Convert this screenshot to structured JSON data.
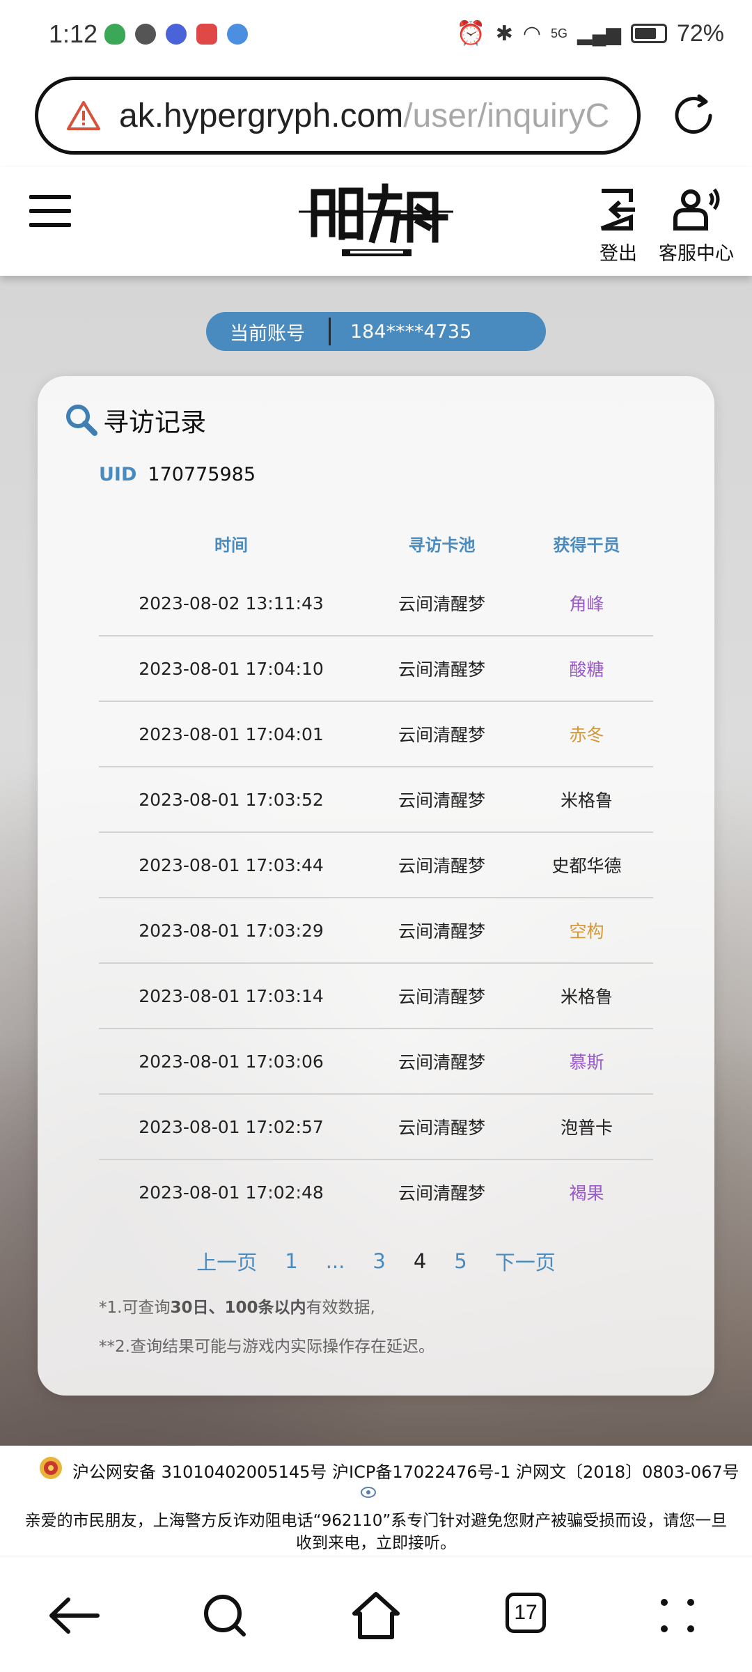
{
  "status_bar": {
    "time": "1:12",
    "network": "5G",
    "battery": "72%"
  },
  "browser": {
    "url_host": "ak.hypergryph.com",
    "url_path": "/user/inquiryC"
  },
  "header": {
    "logout_label": "登出",
    "service_label": "客服中心"
  },
  "account": {
    "label": "当前账号",
    "value": "184****4735"
  },
  "card": {
    "title": "寻访记录",
    "uid_label": "UID",
    "uid_value": "170775985",
    "columns": [
      "时间",
      "寻访卡池",
      "获得干员"
    ],
    "rows": [
      {
        "time": "2023-08-02 13:11:43",
        "pool": "云间清醒梦",
        "operator": "角峰",
        "color": "#9b59c9"
      },
      {
        "time": "2023-08-01 17:04:10",
        "pool": "云间清醒梦",
        "operator": "酸糖",
        "color": "#9b59c9"
      },
      {
        "time": "2023-08-01 17:04:01",
        "pool": "云间清醒梦",
        "operator": "赤冬",
        "color": "#d49a3a"
      },
      {
        "time": "2023-08-01 17:03:52",
        "pool": "云间清醒梦",
        "operator": "米格鲁",
        "color": "#222222"
      },
      {
        "time": "2023-08-01 17:03:44",
        "pool": "云间清醒梦",
        "operator": "史都华德",
        "color": "#222222"
      },
      {
        "time": "2023-08-01 17:03:29",
        "pool": "云间清醒梦",
        "operator": "空构",
        "color": "#d49a3a"
      },
      {
        "time": "2023-08-01 17:03:14",
        "pool": "云间清醒梦",
        "operator": "米格鲁",
        "color": "#222222"
      },
      {
        "time": "2023-08-01 17:03:06",
        "pool": "云间清醒梦",
        "operator": "慕斯",
        "color": "#9b59c9"
      },
      {
        "time": "2023-08-01 17:02:57",
        "pool": "云间清醒梦",
        "operator": "泡普卡",
        "color": "#222222"
      },
      {
        "time": "2023-08-01 17:02:48",
        "pool": "云间清醒梦",
        "operator": "褐果",
        "color": "#9b59c9"
      }
    ],
    "pagination": {
      "prev": "上一页",
      "p1": "1",
      "ellipsis": "...",
      "p3": "3",
      "current": "4",
      "p5": "5",
      "next": "下一页"
    },
    "note1_prefix": "*1.可查询",
    "note1_bold": "30日、100条以内",
    "note1_suffix": "有效数据,",
    "note2": "**2.查询结果可能与游戏内实际操作存在延迟。"
  },
  "footer": {
    "icp": "沪公网安备 31010402005145号  沪ICP备17022476号-1  沪网文〔2018〕0803-067号",
    "anti_fraud_line1": "亲爱的市民朋友，上海警方反诈劝阻电话“962110”系专门针对避免您财产被骗受损而设，请您一旦",
    "anti_fraud_line2": "收到来电，立即接听。"
  },
  "bottom_nav": {
    "tab_count": "17"
  },
  "colors": {
    "accent": "#4a8bbf",
    "rare_purple": "#9b59c9",
    "rare_gold": "#d49a3a"
  }
}
